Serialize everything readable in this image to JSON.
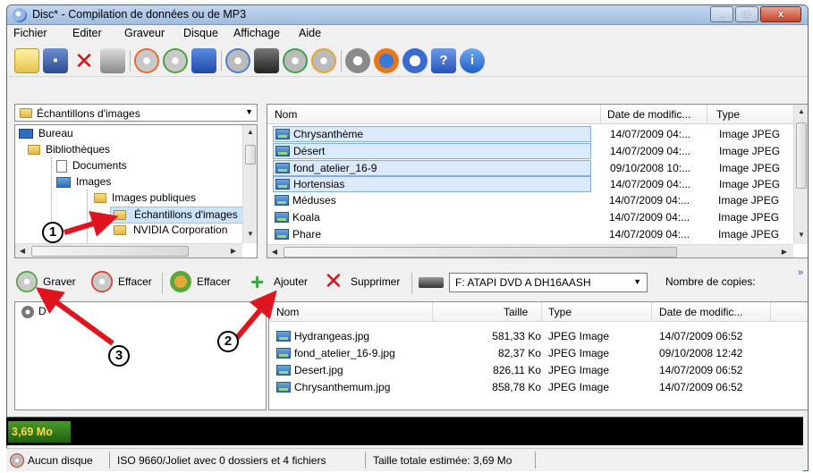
{
  "window": {
    "title": "Disc* - Compilation de données ou de MP3",
    "min_label": "",
    "max_label": "",
    "close_label": "x"
  },
  "menu": [
    "Fichier",
    "Editer",
    "Graveur",
    "Disque",
    "Affichage",
    "Aide"
  ],
  "toolbar": {
    "icons": [
      "new-compilation-icon",
      "save-icon",
      "delete-icon",
      "print-icon",
      "burn-disc-icon",
      "disc-check-icon",
      "burn-image-icon",
      "copy-disc-icon",
      "eject-icon",
      "disc-green-icon",
      "disc-orange-icon",
      "settings-gear-icon",
      "browser-icon",
      "search-disc-icon",
      "help-icon",
      "info-icon"
    ]
  },
  "folder_combo": {
    "value": "Échantillons d'images"
  },
  "tree": [
    {
      "label": "Bureau"
    },
    {
      "label": "Bibliothèques"
    },
    {
      "label": "Documents"
    },
    {
      "label": "Images"
    },
    {
      "label": "Images publiques"
    },
    {
      "label": "Échantillons d'images"
    },
    {
      "label": "NVIDIA Corporation"
    }
  ],
  "file_browser": {
    "columns": {
      "name": "Nom",
      "date": "Date de modific...",
      "type": "Type"
    },
    "rows": [
      {
        "name": "Chrysanthème",
        "date": "14/07/2009 04:...",
        "type": "Image JPEG",
        "selected": true
      },
      {
        "name": "Désert",
        "date": "14/07/2009 04:...",
        "type": "Image JPEG",
        "selected": true
      },
      {
        "name": "fond_atelier_16-9",
        "date": "09/10/2008 10:...",
        "type": "Image JPEG",
        "selected": true
      },
      {
        "name": "Hortensias",
        "date": "14/07/2009 04:...",
        "type": "Image JPEG",
        "selected": true
      },
      {
        "name": "Méduses",
        "date": "14/07/2009 04:...",
        "type": "Image JPEG",
        "selected": false
      },
      {
        "name": "Koala",
        "date": "14/07/2009 04:...",
        "type": "Image JPEG",
        "selected": false
      },
      {
        "name": "Phare",
        "date": "14/07/2009 04:...",
        "type": "Image JPEG",
        "selected": false
      }
    ]
  },
  "actions": {
    "burn": "Graver",
    "erase_disc": "Effacer",
    "erase": "Effacer",
    "add": "Ajouter",
    "remove": "Supprimer",
    "drive": "F: ATAPI DVD A  DH16AASH",
    "copies_label": "Nombre de copies:",
    "overflow": "»"
  },
  "disc_tree": {
    "root": "D"
  },
  "compilation": {
    "columns": {
      "name": "Nom",
      "size": "Taille",
      "type": "Type",
      "date": "Date de modific..."
    },
    "rows": [
      {
        "name": "Hydrangeas.jpg",
        "size": "581,33 Ko",
        "type": "JPEG Image",
        "date": "14/07/2009 06:52"
      },
      {
        "name": "fond_atelier_16-9.jpg",
        "size": "82,37 Ko",
        "type": "JPEG Image",
        "date": "09/10/2008 12:42"
      },
      {
        "name": "Desert.jpg",
        "size": "826,11 Ko",
        "type": "JPEG Image",
        "date": "14/07/2009 06:52"
      },
      {
        "name": "Chrysanthemum.jpg",
        "size": "858,78 Ko",
        "type": "JPEG Image",
        "date": "14/07/2009 06:52"
      }
    ]
  },
  "progress": {
    "text": "3,69 Mo",
    "fraction": 0.015
  },
  "status": {
    "disc": "Aucun disque",
    "format": "ISO 9660/Joliet avec 0 dossiers et 4 fichiers",
    "total": "Taille totale estimée: 3,69 Mo"
  },
  "callouts": [
    "1",
    "2",
    "3"
  ],
  "colors": {
    "arrow": "#e0141e",
    "selection": "#dbeafb",
    "progress_text": "#ffd84a",
    "progress_fill": "#2f7a1a"
  }
}
